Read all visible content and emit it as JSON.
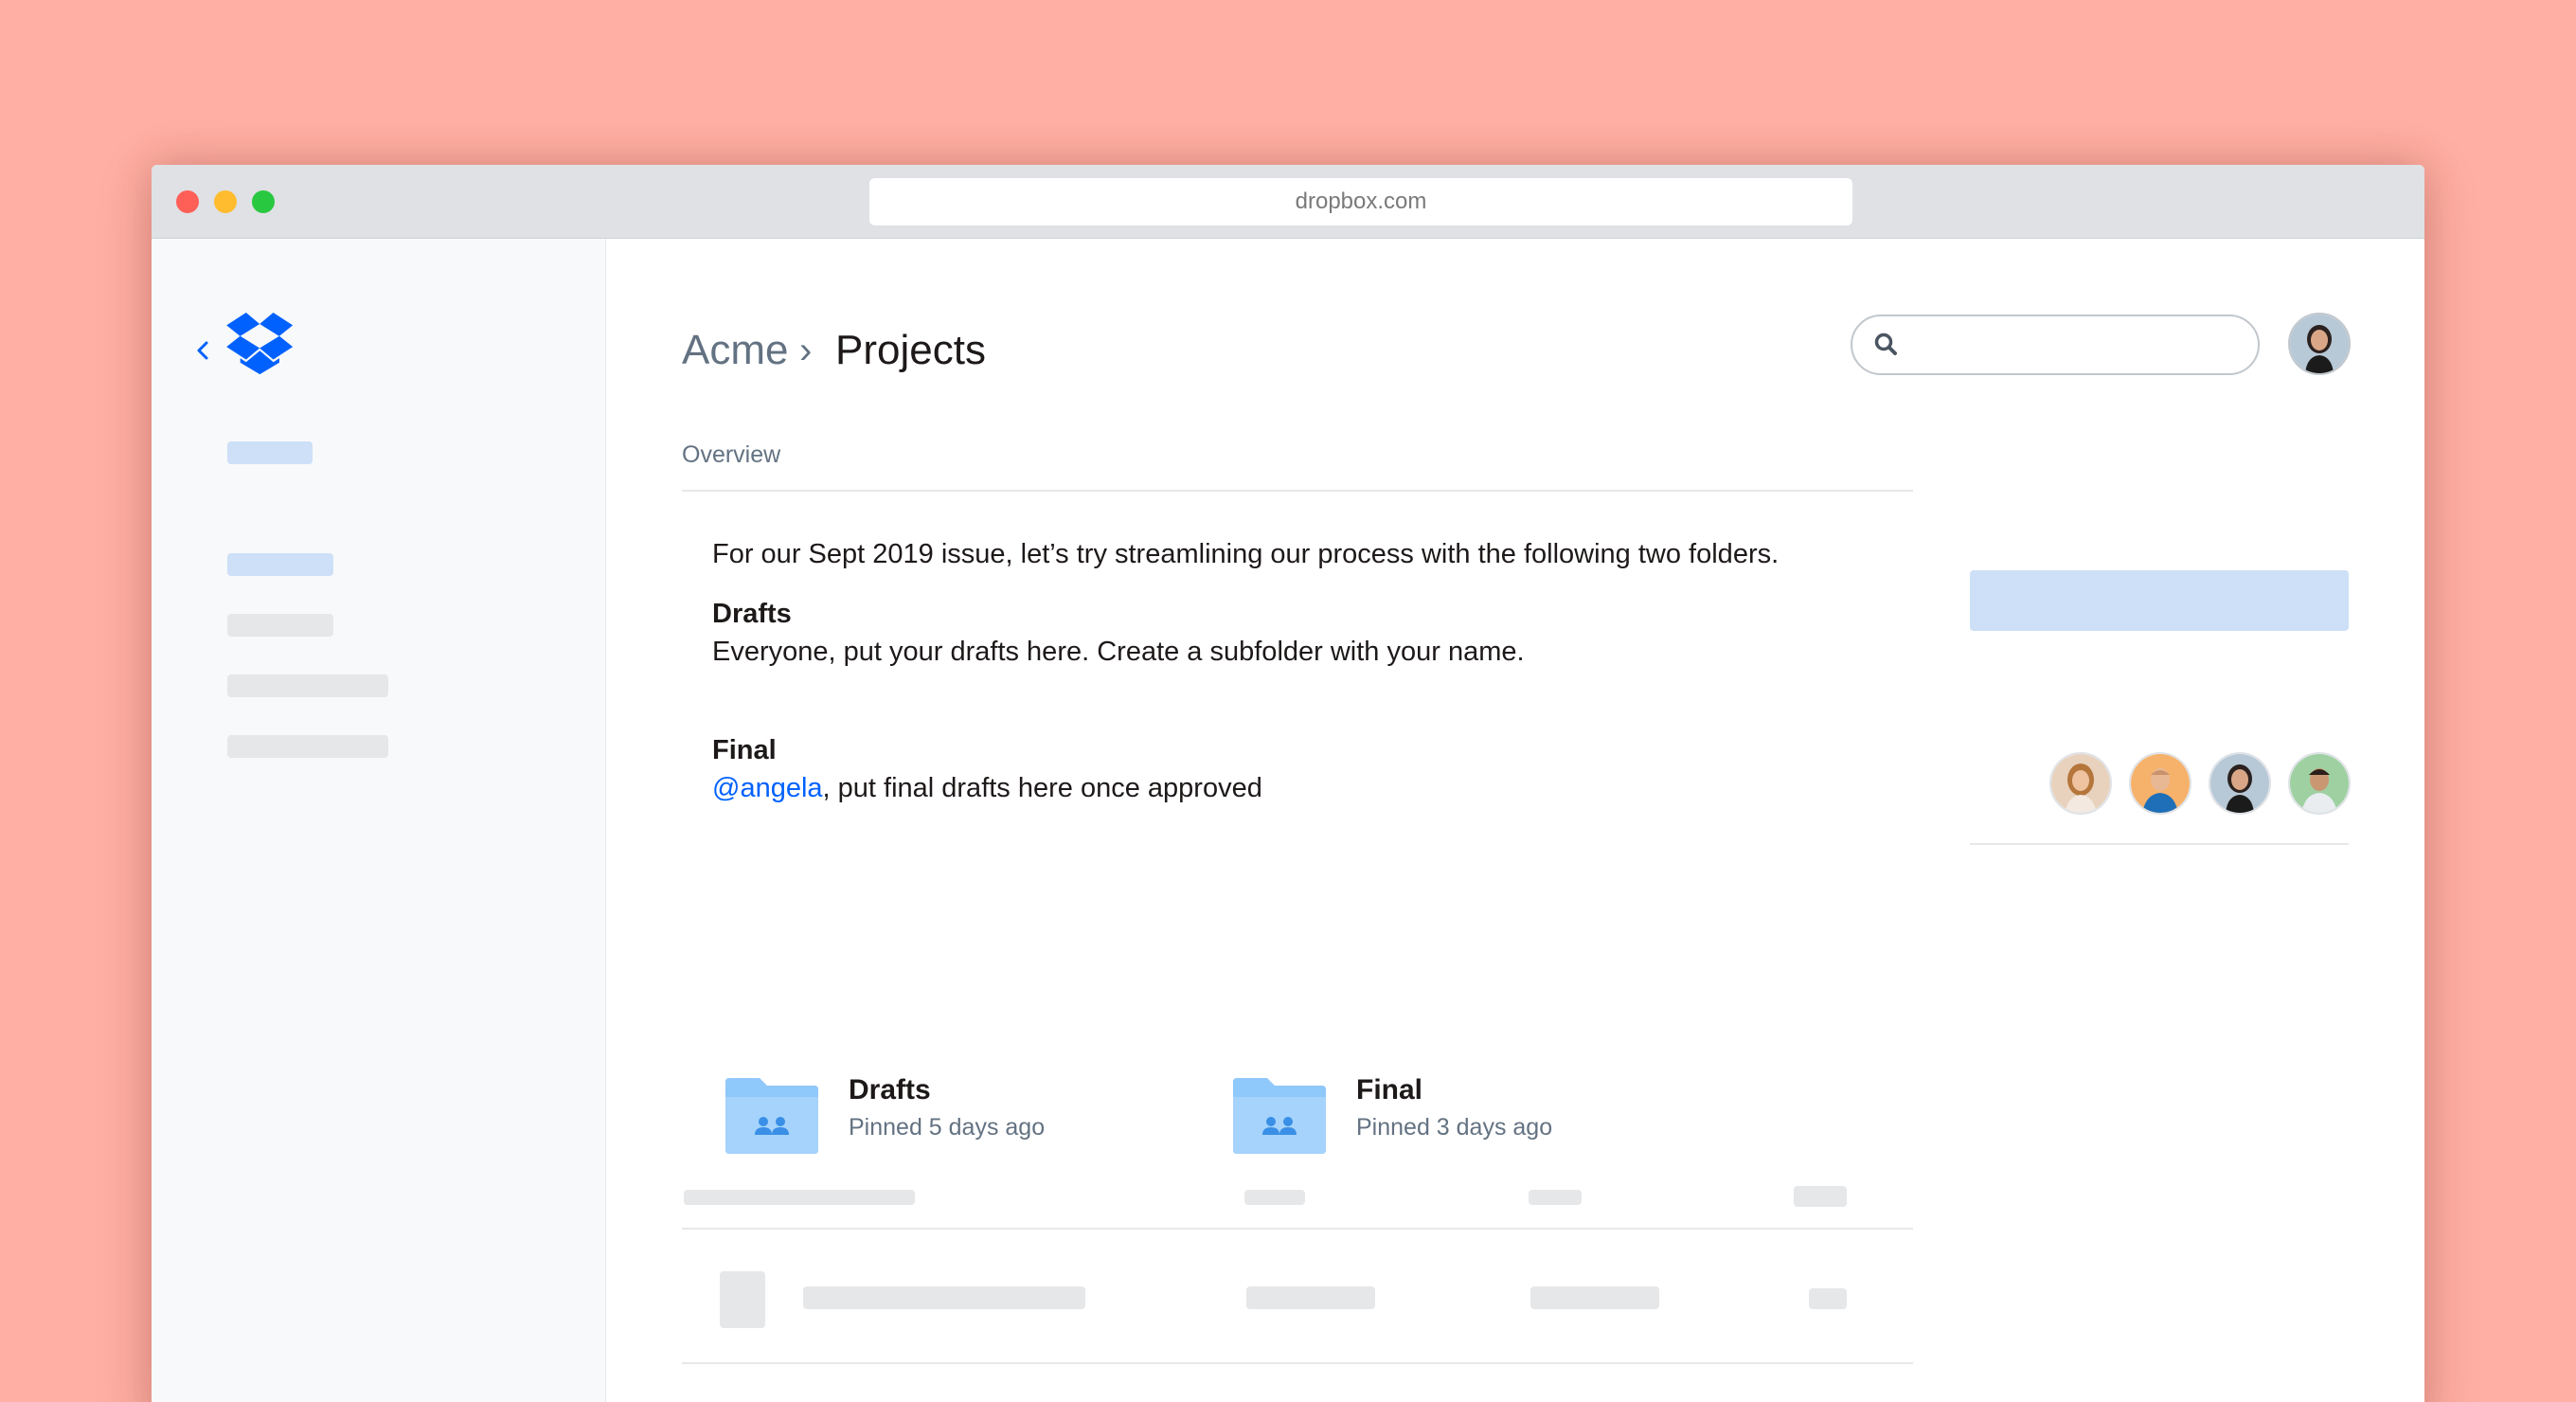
{
  "browser": {
    "url": "dropbox.com"
  },
  "header": {
    "breadcrumb": [
      "Acme",
      "Projects"
    ],
    "breadcrumb_separator": "›",
    "search_placeholder": ""
  },
  "tabs": {
    "overview": "Overview"
  },
  "description": {
    "intro": "For our Sept 2019 issue, let’s try streamlining our process with the following two folders.",
    "drafts_heading": "Drafts",
    "drafts_text": "Everyone, put your drafts here. Create a subfolder with your name.",
    "final_heading": "Final",
    "final_mention": "@angela",
    "final_text": ", put final drafts here once approved"
  },
  "pinned_folders": [
    {
      "name": "Drafts",
      "meta": "Pinned 5 days ago",
      "icon": "shared-folder-icon"
    },
    {
      "name": "Final",
      "meta": "Pinned 3 days ago",
      "icon": "shared-folder-icon"
    }
  ],
  "colors": {
    "accent": "#0061fe",
    "background": "#ffafa3",
    "folder": "#8fc8fb",
    "placeholder_blue": "#cde0f7",
    "placeholder_gray": "#e6e7e8"
  }
}
